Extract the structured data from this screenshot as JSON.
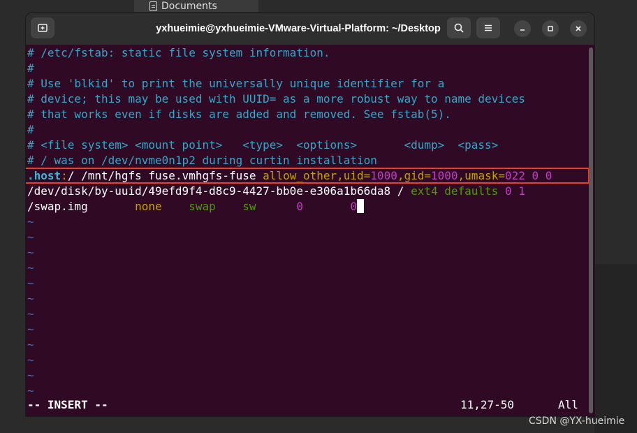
{
  "background": {
    "folder_label": "Documents"
  },
  "window": {
    "title": "yxhueimie@yxhueimie-VMware-Virtual-Platform: ~/Desktop"
  },
  "terminal": {
    "comments": [
      "# /etc/fstab: static file system information.",
      "#",
      "# Use 'blkid' to print the universally unique identifier for a",
      "# device; this may be used with UUID= as a more robust way to name devices",
      "# that works even if disks are added and removed. See fstab(5).",
      "#",
      "# <file system> <mount point>   <type>  <options>       <dump>  <pass>",
      "# / was on /dev/nvme0n1p2 during curtin installation"
    ],
    "host_line": {
      "host": ".host",
      "colon": ":",
      "rest": "/ /mnt/hgfs fuse.vmhgfs-fuse ",
      "opt_allow": "allow_other,",
      "opt_uid_key": "uid=",
      "opt_uid_val": "1000",
      "comma1": ",",
      "opt_gid_key": "gid=",
      "opt_gid_val": "1000",
      "comma2": ",",
      "opt_umask_key": "umask=",
      "opt_umask_val": "022",
      "dump": "0",
      "pass": "0"
    },
    "uuid_line": {
      "device": "/dev/disk/by-uuid/49efd9f4-d8c9-4427-bb0e-e306a1b66da8 / ",
      "type": "ext4",
      "options": "defaults",
      "dump": "0",
      "pass": "1"
    },
    "swap_line": {
      "device": "/swap.img",
      "mount": "none",
      "type": "swap",
      "options": "sw",
      "dump": "0",
      "pass": "0"
    },
    "tilde": "~",
    "tilde_count": 12
  },
  "status": {
    "mode": "-- INSERT --",
    "position": "11,27-50",
    "scroll": "All"
  },
  "watermark": "CSDN @YX-hueimie",
  "icons": {
    "new_tab": "new-tab-icon",
    "search": "search-icon",
    "menu": "hamburger-menu-icon",
    "minimize": "minimize-icon",
    "maximize": "maximize-icon",
    "close": "close-icon"
  }
}
